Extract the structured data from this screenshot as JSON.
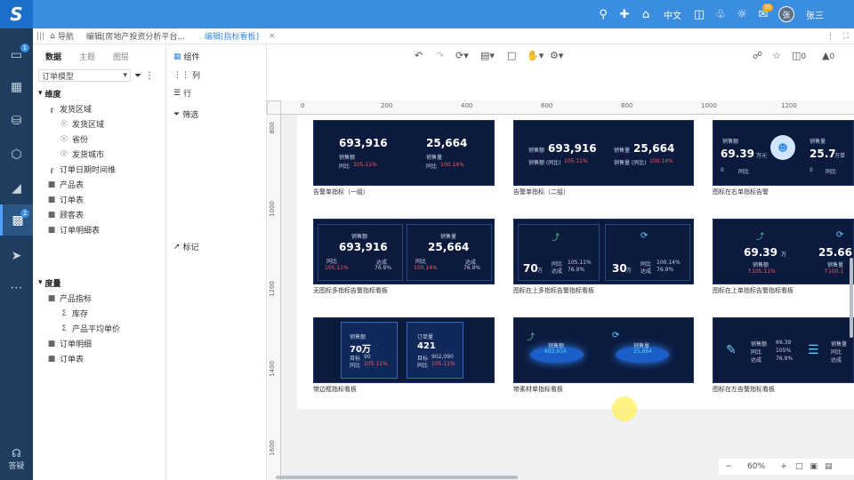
{
  "app": {
    "logo_text": "S",
    "lang": "中文",
    "user": "张三",
    "avatar_char": "张",
    "notice_badge": "25"
  },
  "tabs": {
    "nav": "导航",
    "tab1": "编辑[房地产投资分析平台...",
    "tab2": "编辑[指标看板]"
  },
  "leftnav": {
    "badge1": "1",
    "badge2": "2",
    "help": "答疑"
  },
  "panel": {
    "tab_data": "数据",
    "tab_theme": "主题",
    "tab_layer": "图层",
    "model": "订单模型",
    "dim_head": "维度",
    "dims": [
      "发货区域",
      "发货区域",
      "省份",
      "发货城市",
      "订单日期时间维",
      "产品表",
      "订单表",
      "顾客表",
      "订单明细表"
    ],
    "measure_head": "度量",
    "measures": [
      "产品指标",
      "库存",
      "产品平均单价",
      "订单明细",
      "订单表"
    ]
  },
  "panel2": {
    "components": "组件",
    "column": "列",
    "row": "行",
    "filter": "筛选",
    "mark": "标记"
  },
  "toolbar": {
    "comment_count": "0",
    "like_count": "0"
  },
  "ruler": {
    "top": [
      "0",
      "200",
      "400",
      "600",
      "800",
      "1000",
      "1200"
    ],
    "left": [
      "800",
      "1000",
      "1200",
      "1400",
      "1600"
    ]
  },
  "cards": {
    "c1": {
      "v1": "693,916",
      "l1": "销售额",
      "r1": "同比",
      "p1": "105.11%",
      "v2": "25,664",
      "l2": "销售量",
      "r2": "同比",
      "p2": "100.14%",
      "cap": "告警单指标（一组）"
    },
    "c2": {
      "l1": "销售额",
      "v1": "693,916",
      "r1": "销售额 (同比)",
      "p1": "105.11%",
      "l2": "销售量",
      "v2": "25,664",
      "r2": "销售量 (同比)",
      "p2": "100.14%",
      "cap": "告警单指标（二组）"
    },
    "c3": {
      "l1": "销售额",
      "v1": "69.39",
      "u1": "万元",
      "z1": "0",
      "r1": "同比",
      "l2": "销售量",
      "v2": "25.7",
      "u2": "万单",
      "z2": "0",
      "r2": "同比",
      "cap": "图标在右单指标告警"
    },
    "c4": {
      "l1": "销售额",
      "v1": "693,916",
      "r1": "同比",
      "p1": "105.11%",
      "a1": "达成",
      "q1": "76.9%",
      "v2": "25,664",
      "l2": "销售量",
      "r2": "同比",
      "p2": "100.14%",
      "a2": "达成",
      "q2": "76.9%",
      "cap": "无图标多指标告警指标看板"
    },
    "c5": {
      "v1": "70",
      "u1": "万",
      "r1": "同比",
      "p1": "105.11%",
      "a1": "达成",
      "q1": "76.9%",
      "v2": "30",
      "u2": "万",
      "r2": "同比",
      "p2": "100.14%",
      "a2": "达成",
      "q2": "76.9%",
      "cap": "图标在上多指标告警指标看板"
    },
    "c6": {
      "v1": "69.39",
      "u1": "万",
      "l1": "销售额",
      "p1": "↑105.11%",
      "v2": "25.66",
      "l2": "销售量",
      "p2": "↑100.1",
      "cap": "图标在上单指标告警指标看板"
    },
    "c7": {
      "l1": "销售额",
      "v1": "70万",
      "t1": "目标",
      "tv1": "90",
      "r1": "同比",
      "p1": "105.11%",
      "l2": "订单量",
      "v2": "421",
      "t2": "目标",
      "tv2": "902,090",
      "r2": "同比",
      "p2": "105.11%",
      "cap": "带边框指标看板"
    },
    "c8": {
      "l1": "销售额",
      "v1": "693,916",
      "l2": "销售量",
      "v2": "25,664",
      "cap": "带素材单指标看板"
    },
    "c9": {
      "l1": "销售额",
      "v1": "69.39",
      "r1": "同比",
      "p1": "105%",
      "a1": "达成",
      "q1": "76.9%",
      "l2": "销售量",
      "r2": "同比",
      "a2": "达成",
      "cap": "图标在左告警指标看板"
    }
  },
  "zoom": "60%"
}
